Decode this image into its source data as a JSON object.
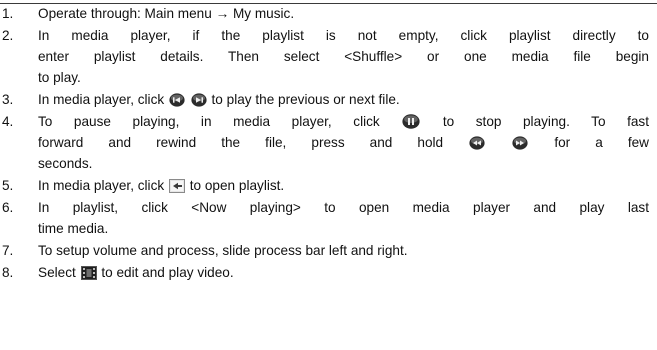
{
  "steps": [
    {
      "number": "1.",
      "lines": [
        {
          "parts": [
            "Operate through: Main menu → My music."
          ]
        }
      ]
    },
    {
      "number": "2.",
      "lines": [
        {
          "parts": [
            "In media player, if the playlist is not empty, click playlist directly to"
          ]
        },
        {
          "parts": [
            "enter playlist details. Then select <Shuffle> or one media file begin"
          ]
        },
        {
          "parts": [
            "to play."
          ]
        }
      ]
    },
    {
      "number": "3.",
      "lines": [
        {
          "parts": [
            "In media player, click",
            "",
            "to play the previous or next file."
          ]
        }
      ]
    },
    {
      "number": "4.",
      "lines": [
        {
          "parts": [
            "To pause playing, in media player, click",
            "to stop playing. To fast"
          ]
        },
        {
          "parts": [
            "forward and rewind the file, press and hold",
            "",
            "for a few"
          ]
        },
        {
          "parts": [
            "seconds."
          ]
        }
      ]
    },
    {
      "number": "5.",
      "lines": [
        {
          "parts": [
            "In media player, click",
            "to open playlist."
          ]
        }
      ]
    },
    {
      "number": "6.",
      "lines": [
        {
          "parts": [
            "In playlist, click <Now playing> to open media player and play last"
          ]
        },
        {
          "parts": [
            "time media."
          ]
        }
      ]
    },
    {
      "number": "7.",
      "lines": [
        {
          "parts": [
            "To setup volume and process, slide process bar left and right."
          ]
        }
      ]
    },
    {
      "number": "8.",
      "lines": [
        {
          "parts": [
            "Select",
            "to edit and play video."
          ]
        }
      ]
    }
  ],
  "icons": {
    "previous": "previous-track-icon",
    "next": "next-track-icon",
    "pause": "pause-icon",
    "rewind": "rewind-icon",
    "fast_forward": "fast-forward-icon",
    "playlist": "playlist-icon",
    "video": "video-icon"
  }
}
